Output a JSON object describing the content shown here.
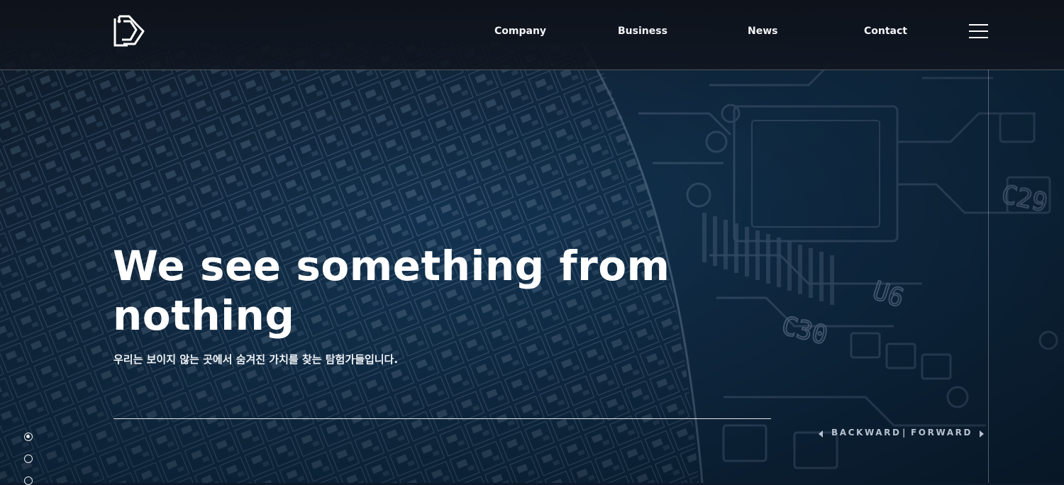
{
  "header": {
    "logo_alt": "logo",
    "nav": [
      {
        "label": "Company"
      },
      {
        "label": "Business"
      },
      {
        "label": "News"
      },
      {
        "label": "Contact"
      }
    ],
    "menu_icon": "hamburger-menu-icon"
  },
  "hero": {
    "headline_line1": "We see something from",
    "headline_line2": "nothing",
    "subline": "우리는 보이지 않는 곳에서 숨겨진 가치를 찾는 탐험가들입니다.",
    "backward_label": "BACKWARD",
    "separator": "|",
    "forward_label": "FORWARD"
  },
  "slider": {
    "active_index": 1,
    "total_visible": 3
  },
  "colors": {
    "accent": "#ffffff",
    "bg_dark": "#0c1a2c",
    "header_bg": "#12161e"
  }
}
